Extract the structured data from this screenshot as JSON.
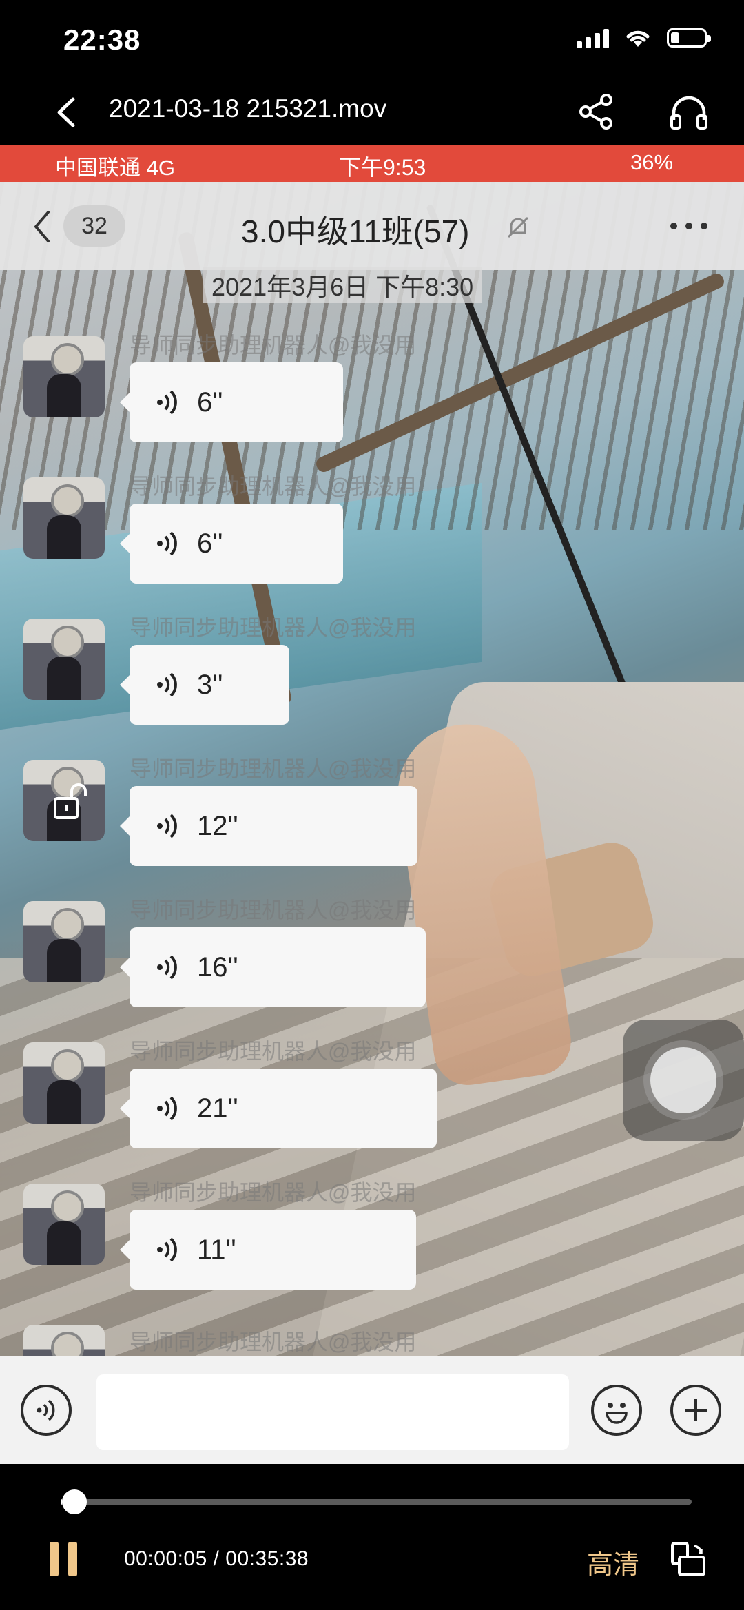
{
  "status_bar": {
    "time": "22:38"
  },
  "nav": {
    "title": "2021-03-18 215321.mov"
  },
  "recording": {
    "status": {
      "carrier": "中国联通 4G",
      "time": "下午9:53",
      "battery": "36%"
    },
    "chat": {
      "unread_badge": "32",
      "title": "3.0中级11班(57)",
      "date": "2021年3月6日 下午8:30",
      "messages": [
        {
          "sender": "导师同步助理机器人@我没用",
          "duration": "6''"
        },
        {
          "sender": "导师同步助理机器人@我没用",
          "duration": "6''"
        },
        {
          "sender": "导师同步助理机器人@我没用",
          "duration": "3''"
        },
        {
          "sender": "导师同步助理机器人@我没用",
          "duration": "12''"
        },
        {
          "sender": "导师同步助理机器人@我没用",
          "duration": "16''"
        },
        {
          "sender": "导师同步助理机器人@我没用",
          "duration": "21''"
        },
        {
          "sender": "导师同步助理机器人@我没用",
          "duration": "11''"
        },
        {
          "sender": "导师同步助理机器人@我没用",
          "duration": ""
        }
      ]
    }
  },
  "player": {
    "time_label": "00:00:05 / 00:35:38",
    "progress": 0.002,
    "quality_label": "高清"
  },
  "colors": {
    "accent": "#f0c78a",
    "recording_status_bar": "#e24a3b"
  }
}
